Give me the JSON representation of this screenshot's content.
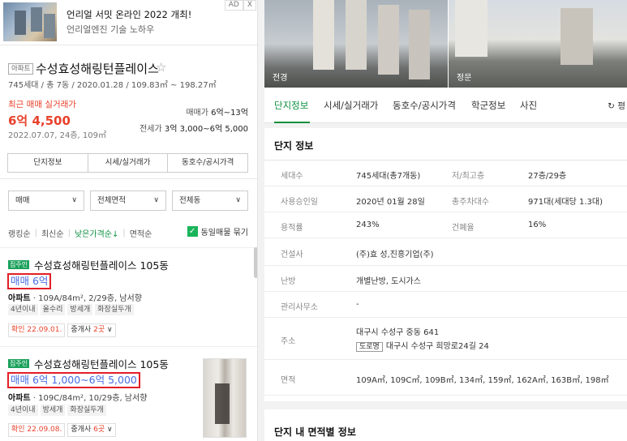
{
  "ad": {
    "title": "언리얼 서밋 온라인 2022 개최!",
    "subtitle": "언리얼엔진 기술 노하우",
    "ad_label": "AD",
    "close_label": "X"
  },
  "complex": {
    "type": "아파트",
    "name": "수성효성해링턴플레이스",
    "meta": "745세대 / 총 7동 / 2020.01.28 / 109.83㎡ ~ 198.27㎡",
    "recent_label": "최근 매매 실거래가",
    "recent_price": "6억 4,500",
    "recent_date": "2022.07.07, 24층, 109㎡",
    "sale_range_label": "매매가",
    "sale_range": "6억~13억",
    "lease_range_label": "전세가",
    "lease_range": "3억 3,000~6억 5,000",
    "buttons": [
      "단지정보",
      "시세/실거래가",
      "동호수/공시가격"
    ]
  },
  "filters": {
    "deal": "매매",
    "area": "전체면적",
    "building": "전체동"
  },
  "sort": {
    "items": [
      "랭킹순",
      "최신순",
      "낮은가격순↓",
      "면적순"
    ],
    "active_index": 2,
    "same_listing_label": "동일매물 묶기"
  },
  "listings": [
    {
      "badge": "집주인",
      "name": "수성효성해링턴플레이스 105동",
      "price": "매매 6억",
      "spec_type": "아파트",
      "spec": "109A/84m², 2/29층, 남서향",
      "tags": [
        "4년이내",
        "올수리",
        "방세개",
        "화장실두개"
      ],
      "confirm": "확인 22.09.01.",
      "agents_label": "중개사",
      "agents_count": "2곳"
    },
    {
      "badge": "집주인",
      "name": "수성효성해링턴플레이스 105동",
      "price": "매매 6억 1,000~6억 5,000",
      "spec_type": "아파트",
      "spec": "109C/84m², 10/29층, 남서향",
      "tags": [
        "4년이내",
        "방세개",
        "화장실두개"
      ],
      "confirm": "확인 22.09.08.",
      "agents_label": "중개사",
      "agents_count": "6곳"
    }
  ],
  "photos": [
    "전경",
    "정문"
  ],
  "right_tabs": [
    "단지정보",
    "시세/실거래가",
    "동호수/공시가격",
    "학군정보",
    "사진"
  ],
  "refresh_label": "평",
  "info": {
    "title": "단지 정보",
    "households_label": "세대수",
    "households": "745세대(총7개동)",
    "floors_label": "저/최고층",
    "floors": "27층/29층",
    "approval_label": "사용승인일",
    "approval": "2020년 01월 28일",
    "parking_label": "총주차대수",
    "parking": "971대(세대당 1.3대)",
    "far_label": "용적률",
    "far": "243%",
    "bcr_label": "건폐율",
    "bcr": "16%",
    "builder_label": "건설사",
    "builder": "(주)효 성,진흥기업(주)",
    "heating_label": "난방",
    "heating": "개별난방, 도시가스",
    "office_label": "관리사무소",
    "office": "-",
    "address_label": "주소",
    "address": "대구시 수성구 중동 641",
    "road_badge": "도로명",
    "road_address": "대구시 수성구 희망로24길 24",
    "area_label": "면적",
    "areas": "109A㎡, 109C㎡, 109B㎡, 134㎡, 159㎡, 162A㎡, 163B㎡, 198㎡"
  },
  "area_info_title": "단지 내 면적별 정보",
  "colors": {
    "accent_green": "#0b8f3f",
    "price_red": "#e8412b",
    "highlight_border": "#e21f26",
    "listing_blue": "#4a6ee0"
  }
}
